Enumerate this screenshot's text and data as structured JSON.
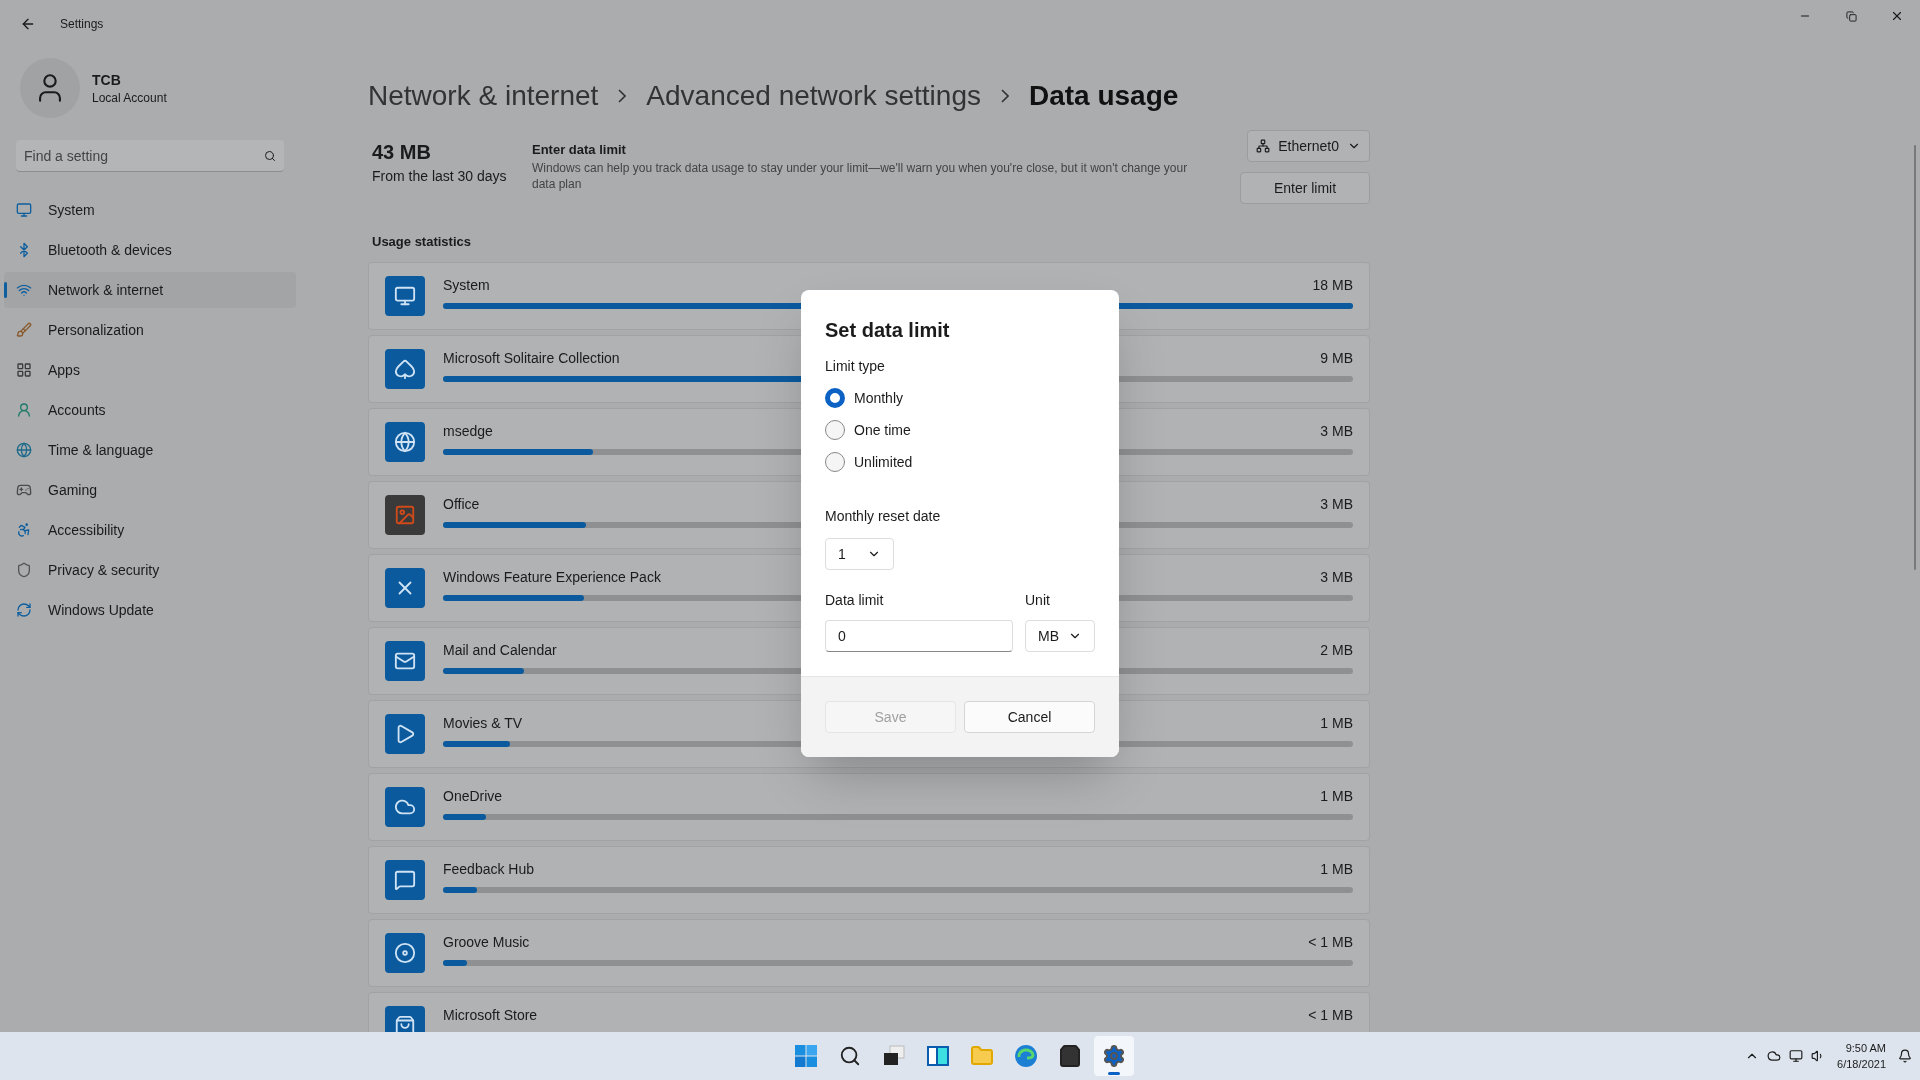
{
  "window": {
    "title": "Settings"
  },
  "account": {
    "name": "TCB",
    "type": "Local Account"
  },
  "search": {
    "placeholder": "Find a setting"
  },
  "nav": [
    {
      "label": "System",
      "selected": false
    },
    {
      "label": "Bluetooth & devices",
      "selected": false
    },
    {
      "label": "Network & internet",
      "selected": true
    },
    {
      "label": "Personalization",
      "selected": false
    },
    {
      "label": "Apps",
      "selected": false
    },
    {
      "label": "Accounts",
      "selected": false
    },
    {
      "label": "Time & language",
      "selected": false
    },
    {
      "label": "Gaming",
      "selected": false
    },
    {
      "label": "Accessibility",
      "selected": false
    },
    {
      "label": "Privacy & security",
      "selected": false
    },
    {
      "label": "Windows Update",
      "selected": false
    }
  ],
  "breadcrumb": [
    "Network & internet",
    "Advanced network settings",
    "Data usage"
  ],
  "summary": {
    "amount": "43 MB",
    "period": "From the last 30 days"
  },
  "limit": {
    "title": "Enter data limit",
    "description": "Windows can help you track data usage to stay under your limit—we'll warn you when you're close, but it won't change your data plan",
    "button": "Enter limit"
  },
  "adapter": {
    "label": "Ethernet0"
  },
  "usage": {
    "heading": "Usage statistics",
    "items": [
      {
        "name": "System",
        "amount": "18 MB",
        "level": 1
      },
      {
        "name": "Microsoft Solitaire Collection",
        "amount": "9 MB",
        "level": 0.5
      },
      {
        "name": "msedge",
        "amount": "3 MB",
        "level": 0.165
      },
      {
        "name": "Office",
        "amount": "3 MB",
        "level": 0.157
      },
      {
        "name": "Windows Feature Experience Pack",
        "amount": "3 MB",
        "level": 0.155
      },
      {
        "name": "Mail and Calendar",
        "amount": "2 MB",
        "level": 0.089
      },
      {
        "name": "Movies & TV",
        "amount": "1 MB",
        "level": 0.074
      },
      {
        "name": "OneDrive",
        "amount": "1 MB",
        "level": 0.047
      },
      {
        "name": "Feedback Hub",
        "amount": "1 MB",
        "level": 0.037
      },
      {
        "name": "Groove Music",
        "amount": "< 1 MB",
        "level": 0.026
      },
      {
        "name": "Microsoft Store",
        "amount": "< 1 MB"
      }
    ]
  },
  "dialog": {
    "title": "Set data limit",
    "limit_type_label": "Limit type",
    "options": [
      {
        "label": "Monthly",
        "selected": true
      },
      {
        "label": "One time",
        "selected": false
      },
      {
        "label": "Unlimited",
        "selected": false
      }
    ],
    "reset_label": "Monthly reset date",
    "reset_value": "1",
    "data_limit_label": "Data limit",
    "data_limit_value": "0",
    "unit_label": "Unit",
    "unit_value": "MB",
    "buttons": [
      {
        "label": "Save",
        "disabled": true
      },
      {
        "label": "Cancel",
        "disabled": false
      }
    ]
  },
  "taskbar": {
    "apps": [
      {
        "kind": "start",
        "selected": false
      },
      {
        "kind": "search",
        "selected": false
      },
      {
        "kind": "taskview",
        "selected": false
      },
      {
        "kind": "widgets",
        "selected": false
      },
      {
        "kind": "explorer",
        "selected": false
      },
      {
        "kind": "edge",
        "selected": false
      },
      {
        "kind": "store",
        "selected": false
      },
      {
        "kind": "settings",
        "selected": true
      }
    ]
  },
  "clock": {
    "time": "9:50 AM",
    "date": "6/18/2021"
  }
}
